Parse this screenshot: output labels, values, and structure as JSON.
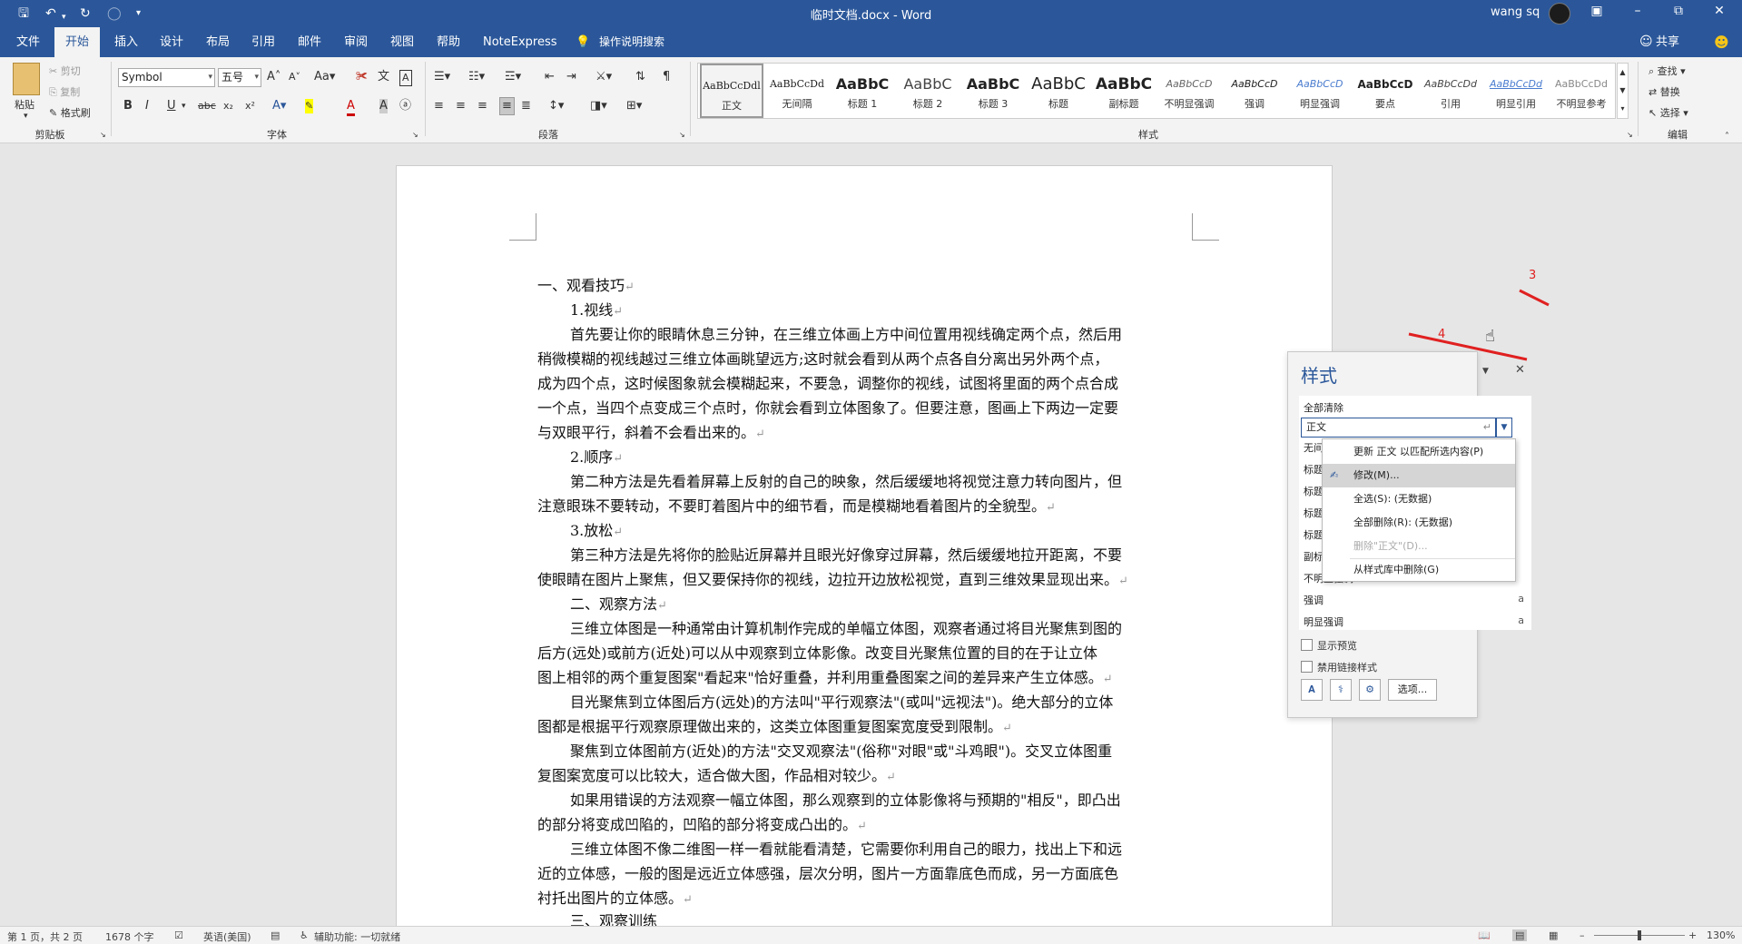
{
  "title_bar": {
    "title": "临时文档.docx - Word",
    "user": "wang sq",
    "undo_icon": "undo-icon",
    "redo_icon": "redo-icon"
  },
  "tabs": [
    "文件",
    "开始",
    "插入",
    "设计",
    "布局",
    "引用",
    "邮件",
    "审阅",
    "视图",
    "帮助",
    "NoteExpress",
    "操作说明搜索"
  ],
  "active_tab": "开始",
  "share": "共享",
  "ribbon": {
    "clipboard": {
      "paste": "粘贴",
      "cut": "剪切",
      "copy": "复制",
      "format_painter": "格式刷",
      "group": "剪贴板"
    },
    "font": {
      "font_name": "Symbol",
      "font_size": "五号",
      "group": "字体"
    },
    "paragraph": {
      "group": "段落"
    },
    "styles": {
      "group": "样式",
      "items": [
        {
          "preview": "AaBbCcDdl",
          "name": "正文"
        },
        {
          "preview": "AaBbCcDd",
          "name": "无间隔"
        },
        {
          "preview": "AaBbC",
          "name": "标题 1"
        },
        {
          "preview": "AaBbC",
          "name": "标题 2"
        },
        {
          "preview": "AaBbC",
          "name": "标题 3"
        },
        {
          "preview": "AaBbC",
          "name": "标题"
        },
        {
          "preview": "AaBbC",
          "name": "副标题"
        },
        {
          "preview": "AaBbCcD",
          "name": "不明显强调"
        },
        {
          "preview": "AaBbCcD",
          "name": "强调"
        },
        {
          "preview": "AaBbCcD",
          "name": "明显强调"
        },
        {
          "preview": "AaBbCcD",
          "name": "要点"
        },
        {
          "preview": "AaBbCcDd",
          "name": "引用"
        },
        {
          "preview": "AaBbCcDd",
          "name": "明显引用"
        },
        {
          "preview": "AaBbCcDd",
          "name": "不明显参考"
        }
      ]
    },
    "editing": {
      "find": "查找",
      "replace": "替换",
      "select": "选择",
      "group": "编辑"
    }
  },
  "document": {
    "paragraphs": [
      "一、观看技巧",
      "1.视线",
      "首先要让你的眼睛休息三分钟，在三维立体画上方中间位置用视线确定两个点，然后用",
      "稍微模糊的视线越过三维立体画眺望远方;这时就会看到从两个点各自分离出另外两个点，",
      "成为四个点，这时候图象就会模糊起来，不要急，调整你的视线，试图将里面的两个点合成",
      "一个点，当四个点变成三个点时，你就会看到立体图象了。但要注意，图画上下两边一定要",
      "与双眼平行，斜着不会看出来的。",
      "2.顺序",
      "第二种方法是先看着屏幕上反射的自己的映象，然后缓缓地将视觉注意力转向图片，但",
      "注意眼珠不要转动，不要盯着图片中的细节看，而是模糊地看着图片的全貌型。",
      "3.放松",
      "第三种方法是先将你的脸贴近屏幕并且眼光好像穿过屏幕，然后缓缓地拉开距离，不要",
      "使眼睛在图片上聚焦，但又要保持你的视线，边拉开边放松视觉，直到三维效果显现出来。",
      "二、观察方法",
      "三维立体图是一种通常由计算机制作完成的单幅立体图，观察者通过将目光聚焦到图的",
      "后方(远处)或前方(近处)可以从中观察到立体影像。改变目光聚焦位置的目的在于让立体",
      "图上相邻的两个重复图案\"看起来\"恰好重叠，并利用重叠图案之间的差异来产生立体感。",
      "目光聚焦到立体图后方(远处)的方法叫\"平行观察法\"(或叫\"远视法\")。绝大部分的立体",
      "图都是根据平行观察原理做出来的，这类立体图重复图案宽度受到限制。",
      "聚焦到立体图前方(近处)的方法\"交叉观察法\"(俗称\"对眼\"或\"斗鸡眼\")。交叉立体图重",
      "复图案宽度可以比较大，适合做大图，作品相对较少。",
      "如果用错误的方法观察一幅立体图，那么观察到的立体影像将与预期的\"相反\"，即凸出",
      "的部分将变成凹陷的，凹陷的部分将变成凸出的。",
      "三维立体图不像二维图一样一看就能看清楚，它需要你利用自己的眼力，找出上下和远",
      "近的立体感，一般的图是远近立体感强，层次分明，图片一方面靠底色而成，另一方面底色",
      "衬托出图片的立体感。",
      "三、观察训练"
    ]
  },
  "styles_pane": {
    "title": "样式",
    "clear_all": "全部清除",
    "current_style": "正文",
    "list": [
      {
        "name": "无间隔",
        "mark": "↵"
      },
      {
        "name": "标题 1",
        "mark": "↵a"
      },
      {
        "name": "标题 2",
        "mark": "↵a"
      },
      {
        "name": "标题 3",
        "mark": "↵a"
      },
      {
        "name": "标题",
        "mark": "↵a"
      },
      {
        "name": "副标题",
        "mark": "↵a"
      },
      {
        "name": "不明显强调",
        "mark": "a"
      },
      {
        "name": "强调",
        "mark": "a"
      },
      {
        "name": "明显强调",
        "mark": "a"
      }
    ],
    "show_preview": "显示预览",
    "disable_linked": "禁用链接样式",
    "options": "选项..."
  },
  "context_menu": {
    "items": [
      "更新 正文 以匹配所选内容(P)",
      "修改(M)...",
      "全选(S): (无数据)",
      "全部删除(R): (无数据)",
      "删除\"正文\"(D)...",
      "从样式库中删除(G)"
    ]
  },
  "annotations": {
    "step3": "3",
    "step4": "4"
  },
  "status_bar": {
    "page": "第 1 页，共 2 页",
    "words": "1678 个字",
    "language": "英语(美国)",
    "accessibility": "辅助功能: 一切就绪",
    "zoom": "130%"
  },
  "colors": {
    "accent": "#2b579a",
    "annotation": "#e02020"
  }
}
